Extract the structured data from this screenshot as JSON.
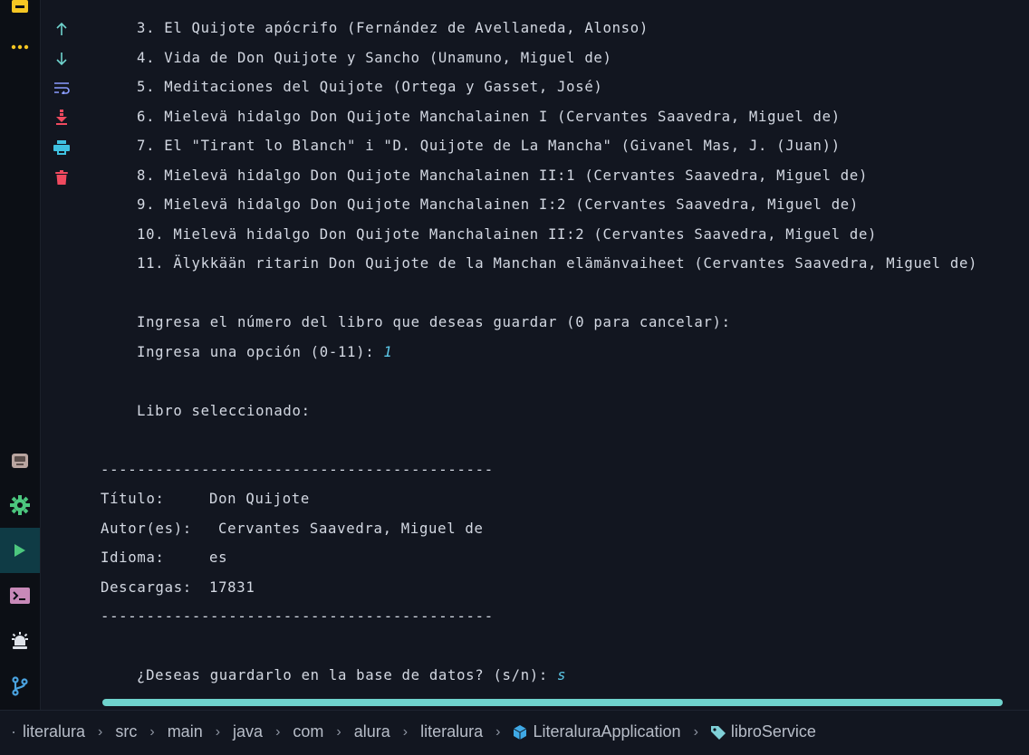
{
  "console": {
    "lines": [
      {
        "text": "3. El Quijote apócrifo (Fernández de Avellaneda, Alonso)"
      },
      {
        "text": "4. Vida de Don Quijote y Sancho (Unamuno, Miguel de)"
      },
      {
        "text": "5. Meditaciones del Quijote (Ortega y Gasset, José)"
      },
      {
        "text": "6. Mielevä hidalgo Don Quijote Manchalainen I (Cervantes Saavedra, Miguel de)"
      },
      {
        "text": "7. El \"Tirant lo Blanch\" i \"D. Quijote de La Mancha\" (Givanel Mas, J. (Juan))"
      },
      {
        "text": "8. Mielevä hidalgo Don Quijote Manchalainen II:1 (Cervantes Saavedra, Miguel de)"
      },
      {
        "text": "9. Mielevä hidalgo Don Quijote Manchalainen I:2 (Cervantes Saavedra, Miguel de)"
      },
      {
        "text": "10. Mielevä hidalgo Don Quijote Manchalainen II:2 (Cervantes Saavedra, Miguel de)"
      },
      {
        "text": "11. Älykkään ritarin Don Quijote de la Manchan elämänvaiheet (Cervantes Saavedra, Miguel de)"
      }
    ],
    "prompt_save": "Ingresa el número del libro que deseas guardar (0 para cancelar):",
    "prompt_option": "Ingresa una opción (0-11): ",
    "option_input": "1",
    "selected_header": "Libro seleccionado:",
    "divider": "-------------------------------------------",
    "book": {
      "title_label": "Título:",
      "title_value": "Don Quijote",
      "author_label": "Autor(es):",
      "author_value": "Cervantes Saavedra, Miguel de",
      "language_label": "Idioma:",
      "language_value": "es",
      "downloads_label": "Descargas:",
      "downloads_value": "17831"
    },
    "confirm_prompt": "¿Deseas guardarlo en la base de datos? (s/n): ",
    "confirm_input": "s"
  },
  "breadcrumb": {
    "items": [
      "literalura",
      "src",
      "main",
      "java",
      "com",
      "alura",
      "literalura",
      "LiteraluraApplication",
      "libroService"
    ]
  },
  "colors": {
    "background": "#121620",
    "text": "#d3d8e2",
    "user_input": "#5cc8e8",
    "scrollbar": "#6fd3cd",
    "accent_green": "#4cc77e",
    "accent_red": "#f04a5f"
  },
  "icons": {
    "toolstrip": [
      "bookmark-icon",
      "more-icon",
      "database-icon",
      "settings-icon",
      "run-icon",
      "terminal-icon",
      "alarm-icon",
      "git-branch-icon"
    ],
    "gutter": [
      "arrow-up-icon",
      "arrow-down-icon",
      "soft-wrap-icon",
      "scroll-to-end-icon",
      "print-icon",
      "trash-icon"
    ]
  }
}
